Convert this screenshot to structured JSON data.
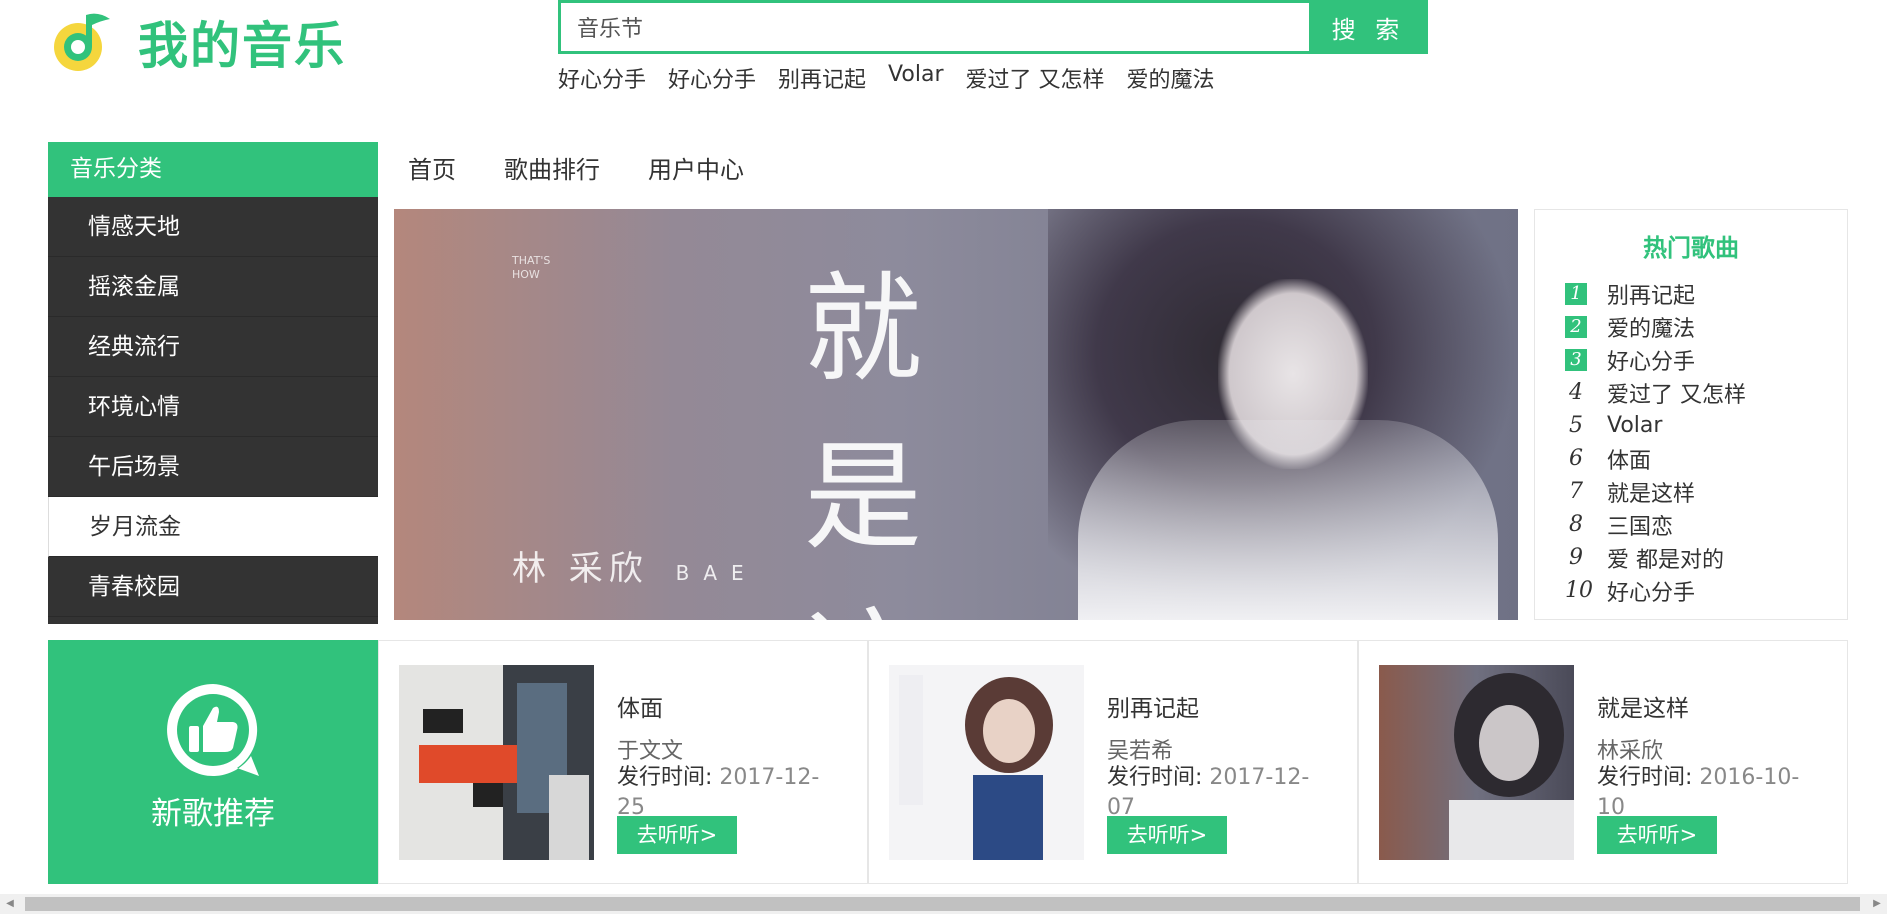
{
  "header": {
    "logo_text": "我的音乐",
    "search": {
      "value": "音乐节",
      "button_label": "搜 索"
    },
    "hot_words": [
      "好心分手",
      "好心分手",
      "别再记起",
      "Volar",
      "爱过了 又怎样",
      "爱的魔法"
    ]
  },
  "sidebar": {
    "title": "音乐分类",
    "items": [
      {
        "label": "情感天地"
      },
      {
        "label": "摇滚金属"
      },
      {
        "label": "经典流行"
      },
      {
        "label": "环境心情"
      },
      {
        "label": "午后场景"
      },
      {
        "label": "岁月流金",
        "active": true
      },
      {
        "label": "青春校园"
      }
    ]
  },
  "nav": {
    "items": [
      "首页",
      "歌曲排行",
      "用户中心"
    ]
  },
  "banner": {
    "title_line1": "就是",
    "title_line2": "这样",
    "artist_cn": "林 采欣",
    "artist_en": "BAE",
    "tag": "THAT'S HOW"
  },
  "hot_songs": {
    "title": "热门歌曲",
    "items": [
      {
        "rank": "1",
        "name": "别再记起"
      },
      {
        "rank": "2",
        "name": "爱的魔法"
      },
      {
        "rank": "3",
        "name": "好心分手"
      },
      {
        "rank": "4",
        "name": "爱过了 又怎样"
      },
      {
        "rank": "5",
        "name": "Volar"
      },
      {
        "rank": "6",
        "name": "体面"
      },
      {
        "rank": "7",
        "name": "就是这样"
      },
      {
        "rank": "8",
        "name": "三国恋"
      },
      {
        "rank": "9",
        "name": "爱 都是对的"
      },
      {
        "rank": "10",
        "name": "好心分手"
      }
    ]
  },
  "new_songs": {
    "label": "新歌推荐",
    "date_label": "发行时间:",
    "listen_label": "去听听>",
    "items": [
      {
        "name": "体面",
        "artist": "于文文",
        "date": "2017-12-25"
      },
      {
        "name": "别再记起",
        "artist": "吴若希",
        "date": "2017-12-07"
      },
      {
        "name": "就是这样",
        "artist": "林采欣",
        "date": "2016-10-10"
      }
    ]
  },
  "colors": {
    "accent": "#31c27c",
    "sidebar_bg": "#333333"
  }
}
